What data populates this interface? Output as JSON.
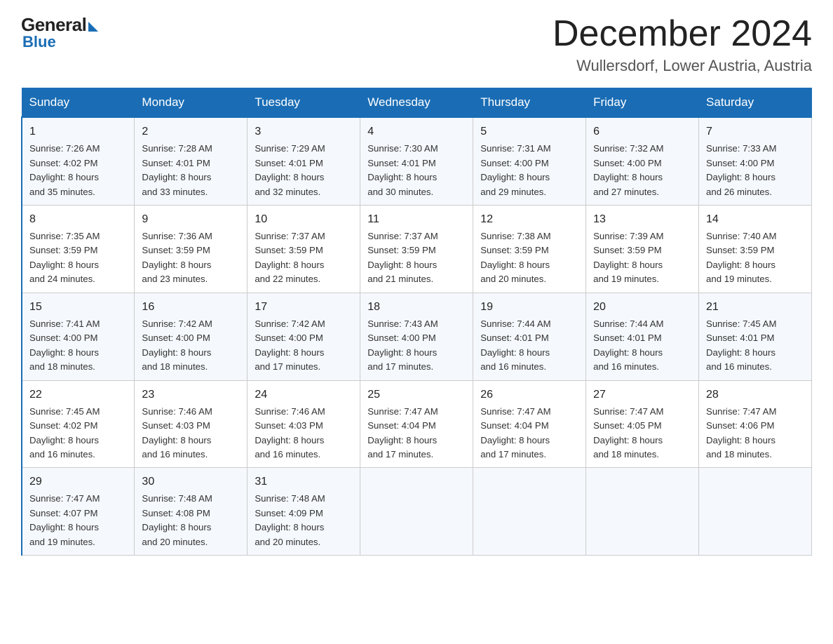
{
  "header": {
    "logo_general": "General",
    "logo_blue": "Blue",
    "month_title": "December 2024",
    "location": "Wullersdorf, Lower Austria, Austria"
  },
  "days_of_week": [
    "Sunday",
    "Monday",
    "Tuesday",
    "Wednesday",
    "Thursday",
    "Friday",
    "Saturday"
  ],
  "weeks": [
    [
      {
        "day": "1",
        "sunrise": "7:26 AM",
        "sunset": "4:02 PM",
        "daylight": "8 hours and 35 minutes."
      },
      {
        "day": "2",
        "sunrise": "7:28 AM",
        "sunset": "4:01 PM",
        "daylight": "8 hours and 33 minutes."
      },
      {
        "day": "3",
        "sunrise": "7:29 AM",
        "sunset": "4:01 PM",
        "daylight": "8 hours and 32 minutes."
      },
      {
        "day": "4",
        "sunrise": "7:30 AM",
        "sunset": "4:01 PM",
        "daylight": "8 hours and 30 minutes."
      },
      {
        "day": "5",
        "sunrise": "7:31 AM",
        "sunset": "4:00 PM",
        "daylight": "8 hours and 29 minutes."
      },
      {
        "day": "6",
        "sunrise": "7:32 AM",
        "sunset": "4:00 PM",
        "daylight": "8 hours and 27 minutes."
      },
      {
        "day": "7",
        "sunrise": "7:33 AM",
        "sunset": "4:00 PM",
        "daylight": "8 hours and 26 minutes."
      }
    ],
    [
      {
        "day": "8",
        "sunrise": "7:35 AM",
        "sunset": "3:59 PM",
        "daylight": "8 hours and 24 minutes."
      },
      {
        "day": "9",
        "sunrise": "7:36 AM",
        "sunset": "3:59 PM",
        "daylight": "8 hours and 23 minutes."
      },
      {
        "day": "10",
        "sunrise": "7:37 AM",
        "sunset": "3:59 PM",
        "daylight": "8 hours and 22 minutes."
      },
      {
        "day": "11",
        "sunrise": "7:37 AM",
        "sunset": "3:59 PM",
        "daylight": "8 hours and 21 minutes."
      },
      {
        "day": "12",
        "sunrise": "7:38 AM",
        "sunset": "3:59 PM",
        "daylight": "8 hours and 20 minutes."
      },
      {
        "day": "13",
        "sunrise": "7:39 AM",
        "sunset": "3:59 PM",
        "daylight": "8 hours and 19 minutes."
      },
      {
        "day": "14",
        "sunrise": "7:40 AM",
        "sunset": "3:59 PM",
        "daylight": "8 hours and 19 minutes."
      }
    ],
    [
      {
        "day": "15",
        "sunrise": "7:41 AM",
        "sunset": "4:00 PM",
        "daylight": "8 hours and 18 minutes."
      },
      {
        "day": "16",
        "sunrise": "7:42 AM",
        "sunset": "4:00 PM",
        "daylight": "8 hours and 18 minutes."
      },
      {
        "day": "17",
        "sunrise": "7:42 AM",
        "sunset": "4:00 PM",
        "daylight": "8 hours and 17 minutes."
      },
      {
        "day": "18",
        "sunrise": "7:43 AM",
        "sunset": "4:00 PM",
        "daylight": "8 hours and 17 minutes."
      },
      {
        "day": "19",
        "sunrise": "7:44 AM",
        "sunset": "4:01 PM",
        "daylight": "8 hours and 16 minutes."
      },
      {
        "day": "20",
        "sunrise": "7:44 AM",
        "sunset": "4:01 PM",
        "daylight": "8 hours and 16 minutes."
      },
      {
        "day": "21",
        "sunrise": "7:45 AM",
        "sunset": "4:01 PM",
        "daylight": "8 hours and 16 minutes."
      }
    ],
    [
      {
        "day": "22",
        "sunrise": "7:45 AM",
        "sunset": "4:02 PM",
        "daylight": "8 hours and 16 minutes."
      },
      {
        "day": "23",
        "sunrise": "7:46 AM",
        "sunset": "4:03 PM",
        "daylight": "8 hours and 16 minutes."
      },
      {
        "day": "24",
        "sunrise": "7:46 AM",
        "sunset": "4:03 PM",
        "daylight": "8 hours and 16 minutes."
      },
      {
        "day": "25",
        "sunrise": "7:47 AM",
        "sunset": "4:04 PM",
        "daylight": "8 hours and 17 minutes."
      },
      {
        "day": "26",
        "sunrise": "7:47 AM",
        "sunset": "4:04 PM",
        "daylight": "8 hours and 17 minutes."
      },
      {
        "day": "27",
        "sunrise": "7:47 AM",
        "sunset": "4:05 PM",
        "daylight": "8 hours and 18 minutes."
      },
      {
        "day": "28",
        "sunrise": "7:47 AM",
        "sunset": "4:06 PM",
        "daylight": "8 hours and 18 minutes."
      }
    ],
    [
      {
        "day": "29",
        "sunrise": "7:47 AM",
        "sunset": "4:07 PM",
        "daylight": "8 hours and 19 minutes."
      },
      {
        "day": "30",
        "sunrise": "7:48 AM",
        "sunset": "4:08 PM",
        "daylight": "8 hours and 20 minutes."
      },
      {
        "day": "31",
        "sunrise": "7:48 AM",
        "sunset": "4:09 PM",
        "daylight": "8 hours and 20 minutes."
      },
      null,
      null,
      null,
      null
    ]
  ],
  "labels": {
    "sunrise": "Sunrise:",
    "sunset": "Sunset:",
    "daylight": "Daylight:"
  }
}
